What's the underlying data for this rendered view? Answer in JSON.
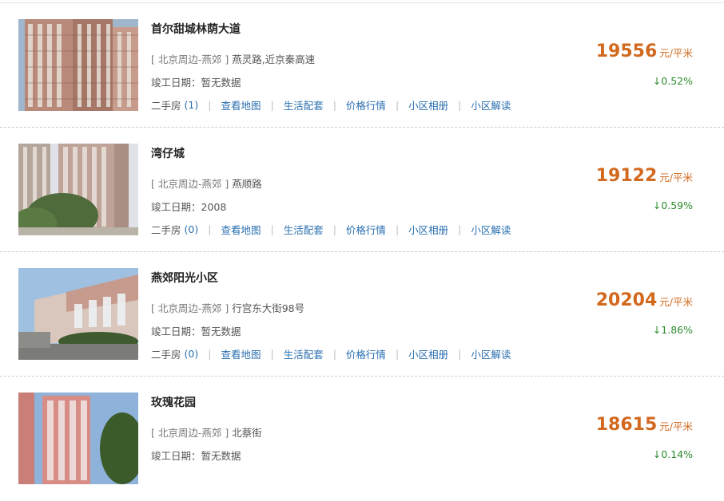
{
  "labels": {
    "completion_prefix": "竣工日期：",
    "second_hand": "二手房",
    "links": [
      "查看地图",
      "生活配套",
      "价格行情",
      "小区相册",
      "小区解读"
    ]
  },
  "colors": {
    "price": "#d2691e",
    "change_down": "#2e8b2e",
    "link": "#2a6fb0"
  },
  "listings": [
    {
      "title": "首尔甜城林荫大道",
      "region": "[ 北京周边-燕郊 ]",
      "address": "燕灵路,近京秦高速",
      "completion": "暂无数据",
      "second_hand_count": "(1)",
      "price": "19556",
      "unit": "元/平米",
      "change": "↓0.52%",
      "thumb_icon": "apartment-tower-photo"
    },
    {
      "title": "湾仔城",
      "region": "[ 北京周边-燕郊 ]",
      "address": "燕顺路",
      "completion": "2008",
      "second_hand_count": "(0)",
      "price": "19122",
      "unit": "元/平米",
      "change": "↓0.59%",
      "thumb_icon": "apartment-tower-photo"
    },
    {
      "title": "燕郊阳光小区",
      "region": "[ 北京周边-燕郊 ]",
      "address": "行宫东大街98号",
      "completion": "暂无数据",
      "second_hand_count": "(0)",
      "price": "20204",
      "unit": "元/平米",
      "change": "↓1.86%",
      "thumb_icon": "residential-street-photo"
    },
    {
      "title": "玫瑰花园",
      "region": "[ 北京周边-燕郊 ]",
      "address": "北蔡街",
      "completion": "暂无数据",
      "second_hand_count": "",
      "price": "18615",
      "unit": "元/平米",
      "change": "↓0.14%",
      "thumb_icon": "pink-apartment-photo"
    }
  ]
}
